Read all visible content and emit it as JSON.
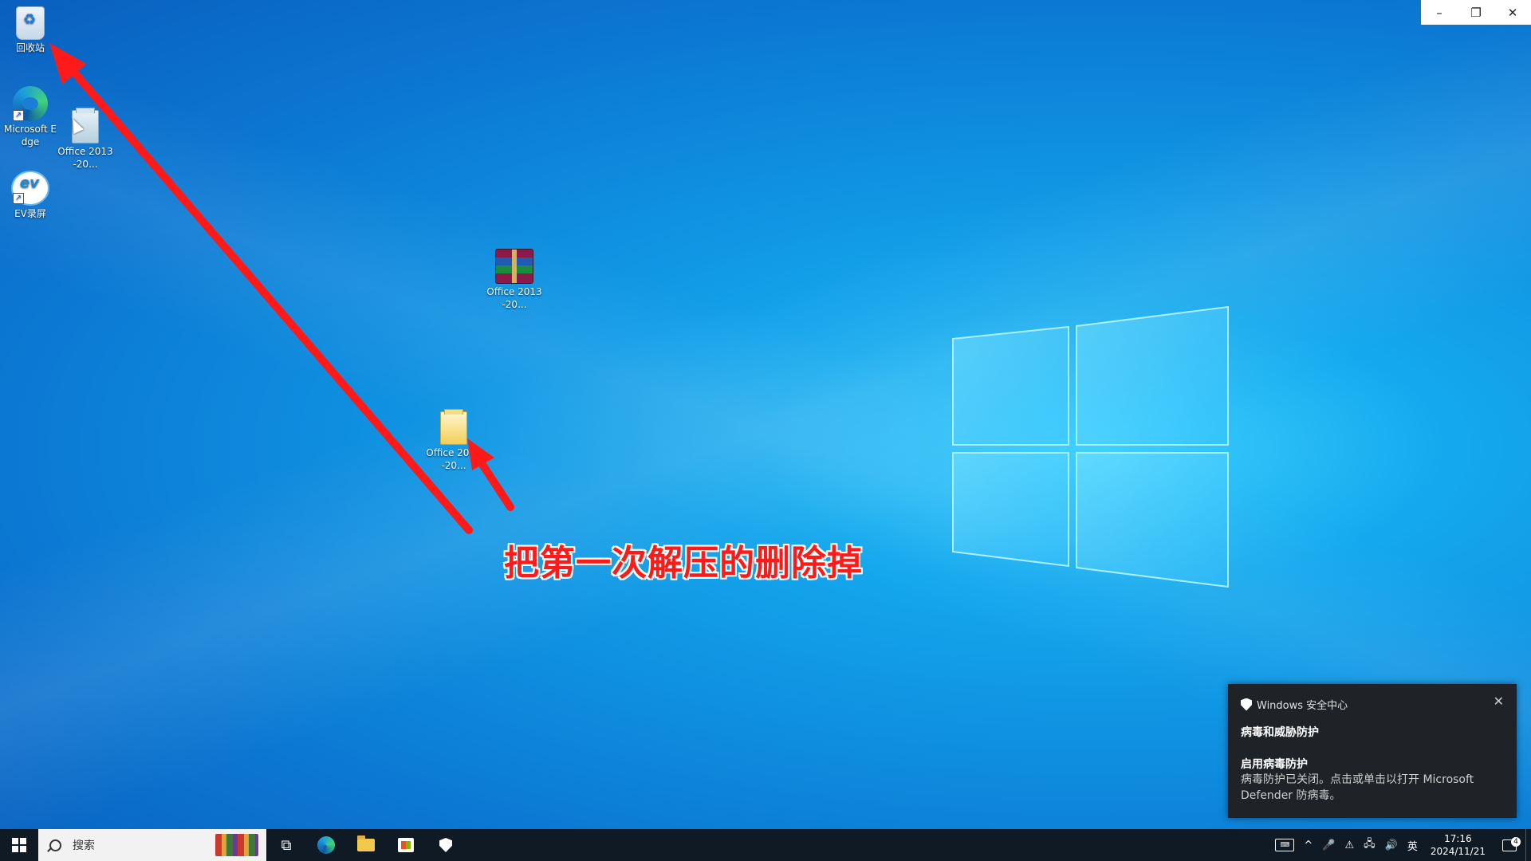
{
  "window_controls": {
    "minimize": "–",
    "restore": "❐",
    "close": "✕"
  },
  "desktop": {
    "icons": {
      "recycle_bin": "回收站",
      "edge": "Microsoft Edge",
      "office_shortcut": "Office 2013-20...",
      "ev": "EV录屏",
      "office_rar": "Office 2013-20...",
      "office_folder": "Office 2013-20..."
    },
    "annotation": "把第一次解压的删除掉",
    "annotation_color": "#ff1a1a"
  },
  "toast": {
    "app": "Windows 安全中心",
    "title": "病毒和威胁防护",
    "subtitle": "启用病毒防护",
    "body": "病毒防护已关闭。点击或单击以打开 Microsoft Defender 防病毒。",
    "close": "✕"
  },
  "taskbar": {
    "search_placeholder": "搜索",
    "tray": {
      "caret": "^",
      "ime": "英",
      "time": "17:16",
      "date": "2024/11/21",
      "notifications_count": "4"
    }
  }
}
